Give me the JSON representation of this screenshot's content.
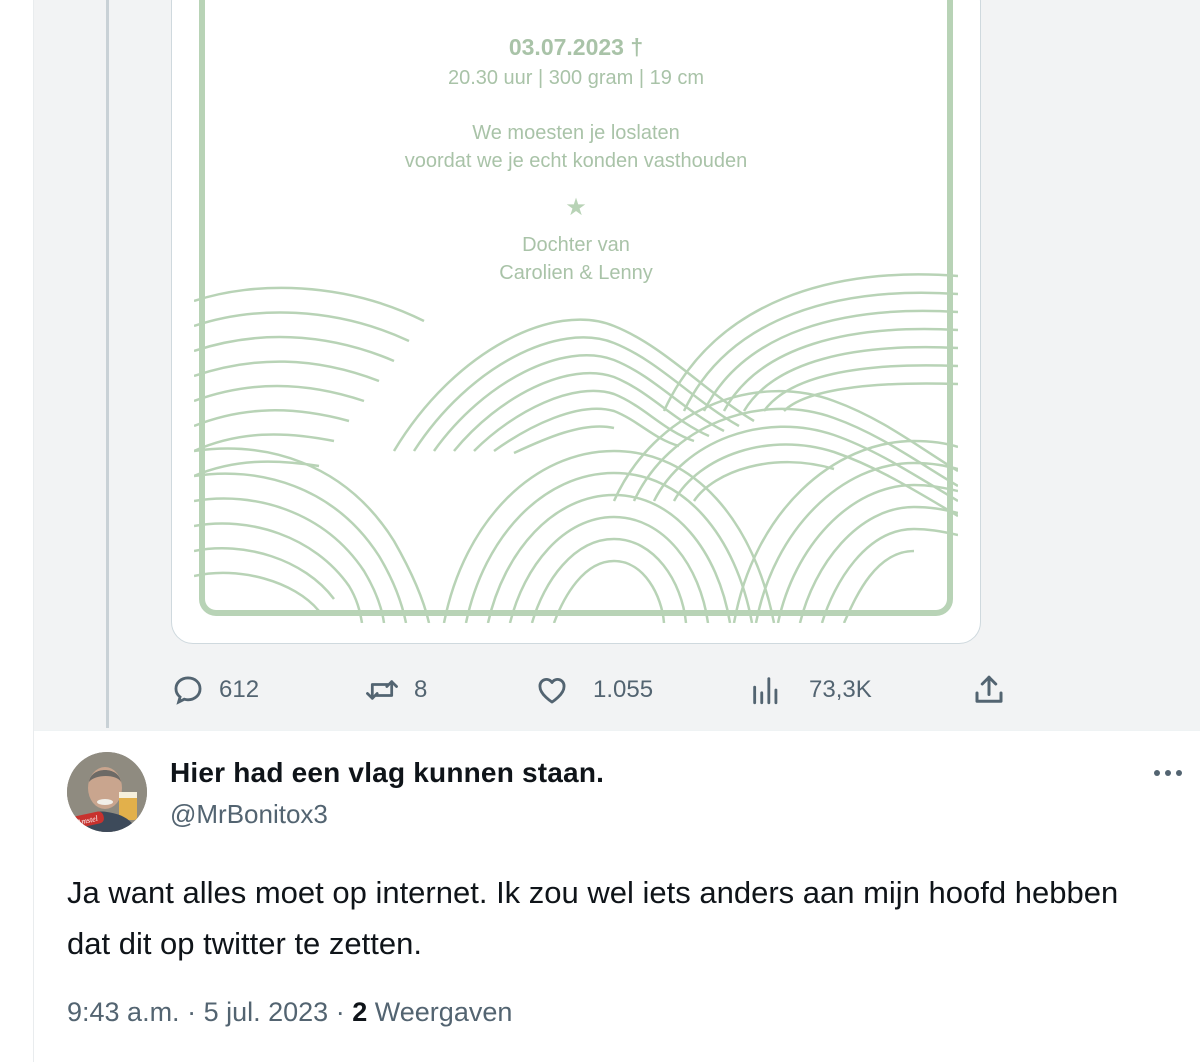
{
  "quoted": {
    "card": {
      "date_line": "03.07.2023 †",
      "details": "20.30 uur | 300 gram | 19 cm",
      "poem_line1": "We moesten je loslaten",
      "poem_line2": "voordat we je echt konden vasthouden",
      "star": "★",
      "parents_line1": "Dochter van",
      "parents_line2": "Carolien & Lenny",
      "accent_color": "#b8d3b6",
      "text_color": "#a9c3a8"
    },
    "actions": {
      "replies": "612",
      "retweets": "8",
      "likes": "1.055",
      "views": "73,3K"
    }
  },
  "reply": {
    "display_name": "Hier had een vlag kunnen staan.",
    "handle": "@MrBonitox3",
    "text": "Ja want alles moet op internet. Ik zou wel iets anders aan mijn hoofd hebben dat dit op twitter te zetten.",
    "time": "9:43 a.m.",
    "separator": "·",
    "date": "5 jul. 2023",
    "views_count": "2",
    "views_label": "Weergaven",
    "avatar_badge": "Amstel"
  },
  "colors": {
    "muted_text": "#536471",
    "primary_text": "#0f1419",
    "quoted_background": "#f2f3f4"
  }
}
